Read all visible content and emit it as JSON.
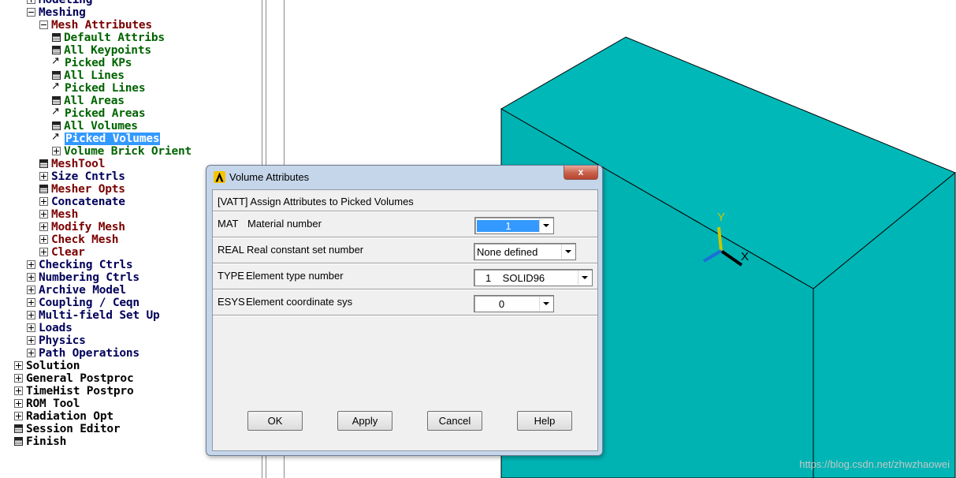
{
  "main_menu": {
    "items": [
      {
        "label": "Modeling",
        "icon": "plus",
        "color": "navy",
        "level": 1
      },
      {
        "label": "Meshing",
        "icon": "minus",
        "color": "navy",
        "level": 1
      },
      {
        "label": "Mesh Attributes",
        "icon": "minus",
        "color": "red",
        "level": 2
      },
      {
        "label": "Default Attribs",
        "icon": "dialog",
        "color": "green",
        "level": 3
      },
      {
        "label": "All Keypoints",
        "icon": "dialog",
        "color": "green",
        "level": 3
      },
      {
        "label": "Picked KPs",
        "icon": "pick",
        "color": "green",
        "level": 3
      },
      {
        "label": "All Lines",
        "icon": "dialog",
        "color": "green",
        "level": 3
      },
      {
        "label": "Picked Lines",
        "icon": "pick",
        "color": "green",
        "level": 3
      },
      {
        "label": "All Areas",
        "icon": "dialog",
        "color": "green",
        "level": 3
      },
      {
        "label": "Picked Areas",
        "icon": "pick",
        "color": "green",
        "level": 3
      },
      {
        "label": "All Volumes",
        "icon": "dialog",
        "color": "green",
        "level": 3
      },
      {
        "label": "Picked Volumes",
        "icon": "pick",
        "color": "green",
        "level": 3,
        "selected": true
      },
      {
        "label": "Volume Brick Orient",
        "icon": "plus",
        "color": "green",
        "level": 3
      },
      {
        "label": "MeshTool",
        "icon": "dialog",
        "color": "red",
        "level": 2
      },
      {
        "label": "Size Cntrls",
        "icon": "plus",
        "color": "navy",
        "level": 2
      },
      {
        "label": "Mesher Opts",
        "icon": "dialog",
        "color": "red",
        "level": 2
      },
      {
        "label": "Concatenate",
        "icon": "plus",
        "color": "navy",
        "level": 2
      },
      {
        "label": "Mesh",
        "icon": "plus",
        "color": "red",
        "level": 2
      },
      {
        "label": "Modify Mesh",
        "icon": "plus",
        "color": "red",
        "level": 2
      },
      {
        "label": "Check Mesh",
        "icon": "plus",
        "color": "red",
        "level": 2
      },
      {
        "label": "Clear",
        "icon": "plus",
        "color": "red",
        "level": 2
      },
      {
        "label": "Checking Ctrls",
        "icon": "plus",
        "color": "navy",
        "level": 1
      },
      {
        "label": "Numbering Ctrls",
        "icon": "plus",
        "color": "navy",
        "level": 1
      },
      {
        "label": "Archive Model",
        "icon": "plus",
        "color": "navy",
        "level": 1
      },
      {
        "label": "Coupling / Ceqn",
        "icon": "plus",
        "color": "navy",
        "level": 1
      },
      {
        "label": "Multi-field Set Up",
        "icon": "plus",
        "color": "navy",
        "level": 1
      },
      {
        "label": "Loads",
        "icon": "plus",
        "color": "navy",
        "level": 1
      },
      {
        "label": "Physics",
        "icon": "plus",
        "color": "navy",
        "level": 1
      },
      {
        "label": "Path Operations",
        "icon": "plus",
        "color": "navy",
        "level": 1
      },
      {
        "label": "Solution",
        "icon": "plus",
        "color": "black",
        "level": 0
      },
      {
        "label": "General Postproc",
        "icon": "plus",
        "color": "black",
        "level": 0
      },
      {
        "label": "TimeHist Postpro",
        "icon": "plus",
        "color": "black",
        "level": 0
      },
      {
        "label": "ROM Tool",
        "icon": "plus",
        "color": "black",
        "level": 0
      },
      {
        "label": "Radiation Opt",
        "icon": "plus",
        "color": "black",
        "level": 0
      },
      {
        "label": "Session Editor",
        "icon": "dialog",
        "color": "black",
        "level": 0
      },
      {
        "label": "Finish",
        "icon": "dialog",
        "color": "black",
        "level": 0
      }
    ]
  },
  "colors": {
    "navy": "#00005a",
    "green": "#006400",
    "red": "#7a0000",
    "black": "#000000",
    "selection": "#3399ff",
    "model_face_front": "#00b3b3",
    "model_face_top": "#00b8b8",
    "model_face_side": "#00b5b5",
    "axis_y": "#c8c800",
    "axis_x": "#000000",
    "axis_z": "#1c6fd6"
  },
  "graphics": {
    "axis_labels": {
      "y": "Y",
      "x": "X"
    },
    "watermark": "https://blog.csdn.net/zhwzhaowei"
  },
  "dialog": {
    "title": "Volume Attributes",
    "close_glyph": "x",
    "header": "[VATT]  Assign Attributes to Picked Volumes",
    "rows": [
      {
        "code": "MAT",
        "label": "Material number",
        "value": "1"
      },
      {
        "code": "REAL",
        "label": "Real constant set number",
        "value": "None defined"
      },
      {
        "code": "TYPE",
        "label": "Element type number",
        "value": "1    SOLID96"
      },
      {
        "code": "ESYS",
        "label": "Element coordinate sys",
        "value": "0"
      }
    ],
    "buttons": {
      "ok": "OK",
      "apply": "Apply",
      "cancel": "Cancel",
      "help": "Help"
    }
  }
}
